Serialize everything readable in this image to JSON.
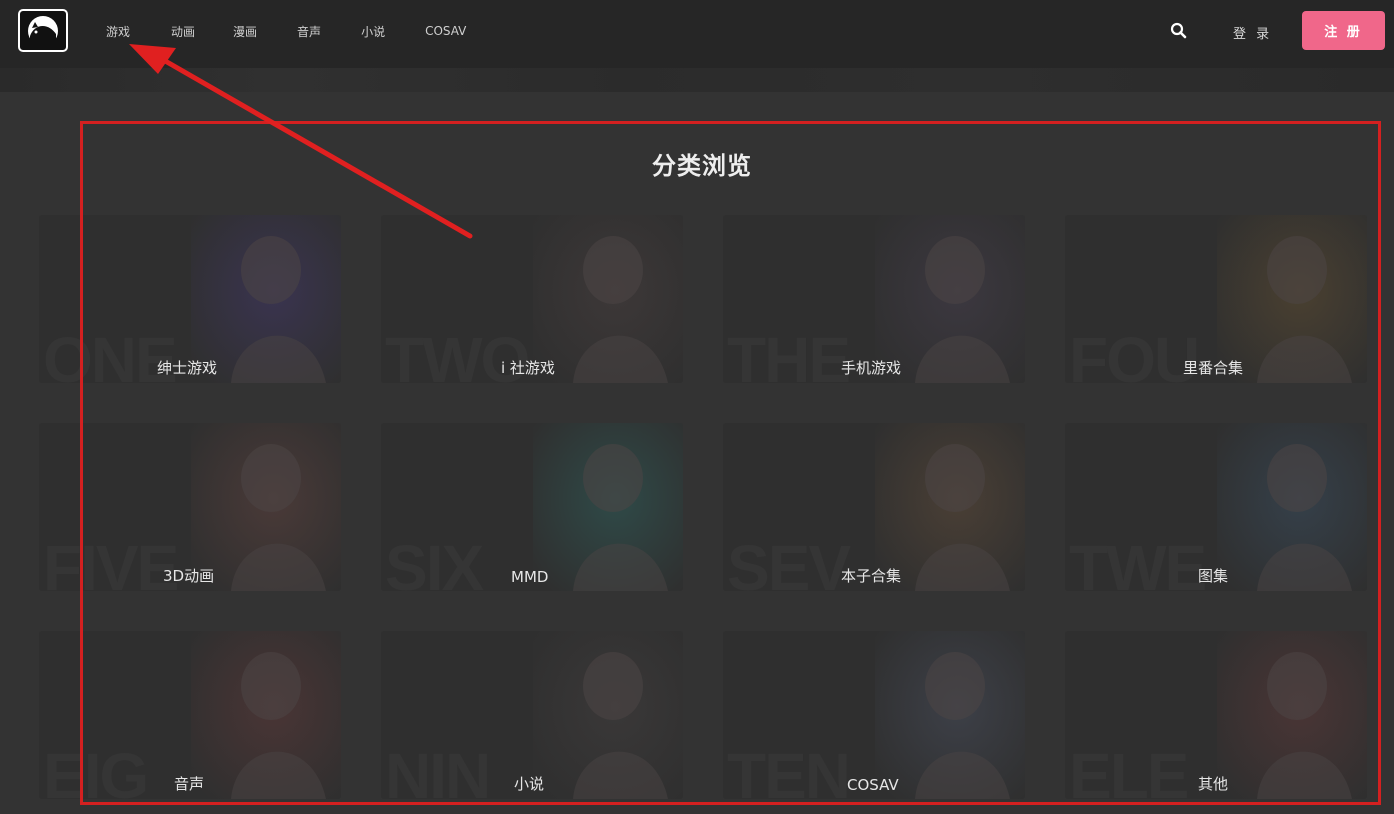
{
  "header": {
    "logo_icon": "cat-logo-icon",
    "nav": [
      "游戏",
      "动画",
      "漫画",
      "音声",
      "小说",
      "COSAV"
    ],
    "search_icon": "search-icon",
    "login_label": "登 录",
    "register_label": "注 册",
    "accent_color": "#f0678a"
  },
  "section": {
    "title": "分类浏览"
  },
  "categories": [
    {
      "label": "绅士游戏",
      "watermark": "ONE"
    },
    {
      "label": "i 社游戏",
      "watermark": "TWO"
    },
    {
      "label": "手机游戏",
      "watermark": "THE"
    },
    {
      "label": "里番合集",
      "watermark": "FOU"
    },
    {
      "label": "3D动画",
      "watermark": "FIVE"
    },
    {
      "label": "MMD",
      "watermark": "SIX"
    },
    {
      "label": "本子合集",
      "watermark": "SEV"
    },
    {
      "label": "图集",
      "watermark": "TWE"
    },
    {
      "label": "音声",
      "watermark": "EIG"
    },
    {
      "label": "小说",
      "watermark": "NIN"
    },
    {
      "label": "COSAV",
      "watermark": "TEN"
    },
    {
      "label": "其他",
      "watermark": "ELE"
    }
  ],
  "annotation": {
    "frame_color": "#d42020",
    "arrow_target": "游戏"
  }
}
